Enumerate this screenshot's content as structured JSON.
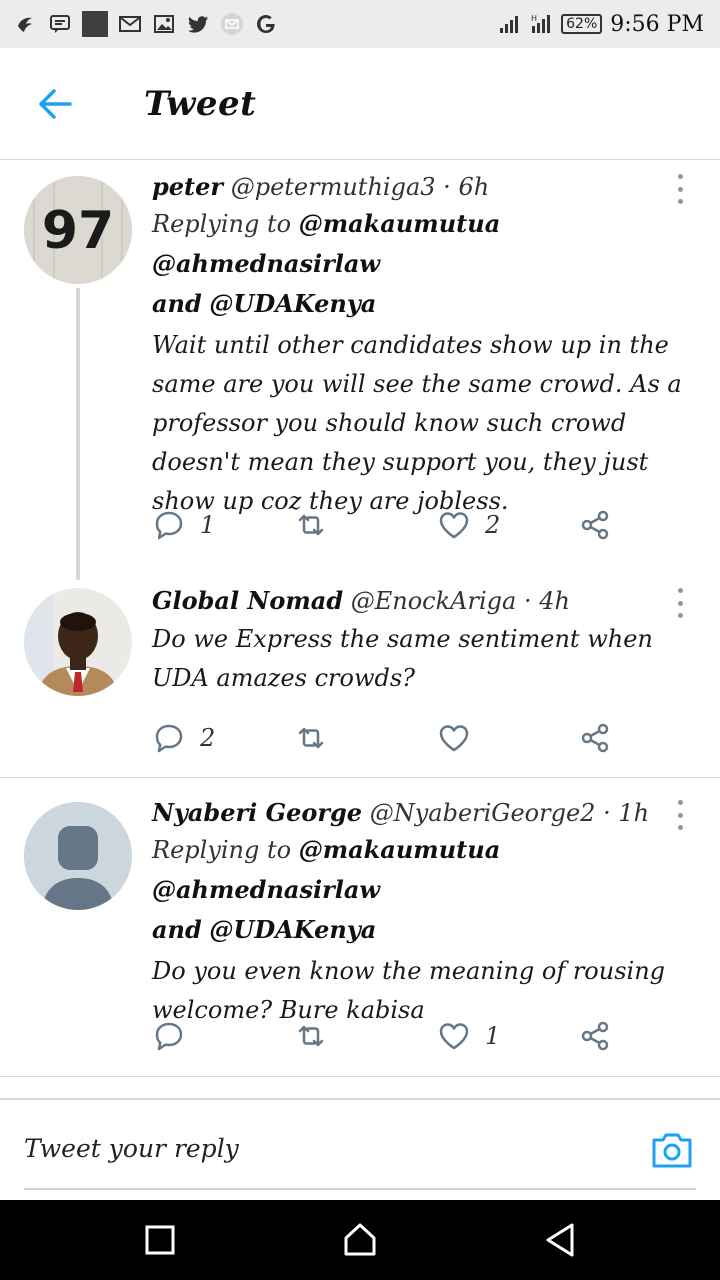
{
  "status_bar": {
    "battery": "62%",
    "time": "9:56 PM"
  },
  "header": {
    "title": "Tweet"
  },
  "tweets": [
    {
      "name": "peter",
      "handle": "@petermuthiga3",
      "time": "6h",
      "replying_prefix": "Replying to",
      "mentions": "@makaumutua @ahmednasirlaw",
      "mentions_and": "and",
      "mentions_last": "@UDAKenya",
      "text": "Wait until other candidates show up in the same are you will see the same crowd. As a professor you should know such crowd doesn't mean they support you, they just show up coz they are jobless.",
      "reply_count": "1",
      "retweet_count": "",
      "like_count": "2"
    },
    {
      "name": "Global Nomad",
      "handle": "@EnockAriga",
      "time": "4h",
      "text": "Do we Express the same sentiment when UDA amazes crowds?",
      "reply_count": "2",
      "retweet_count": "",
      "like_count": ""
    },
    {
      "name": "Nyaberi George",
      "handle": "@NyaberiGeorge2",
      "time": "1h",
      "replying_prefix": "Replying to",
      "mentions": "@makaumutua @ahmednasirlaw",
      "mentions_and": "and",
      "mentions_last": "@UDAKenya",
      "text": "Do you even know the meaning of rousing welcome? Bure kabisa",
      "reply_count": "",
      "retweet_count": "",
      "like_count": "1"
    }
  ],
  "reply_bar": {
    "placeholder": "Tweet your reply"
  },
  "colors": {
    "accent": "#1da1f2",
    "icon_gray": "#657786",
    "divider": "#d9d9d9"
  },
  "icons": {
    "back": "arrow-left-icon",
    "more": "more-vertical-icon",
    "reply": "comment-icon",
    "retweet": "retweet-icon",
    "like": "heart-icon",
    "share": "share-icon",
    "camera": "camera-icon"
  }
}
